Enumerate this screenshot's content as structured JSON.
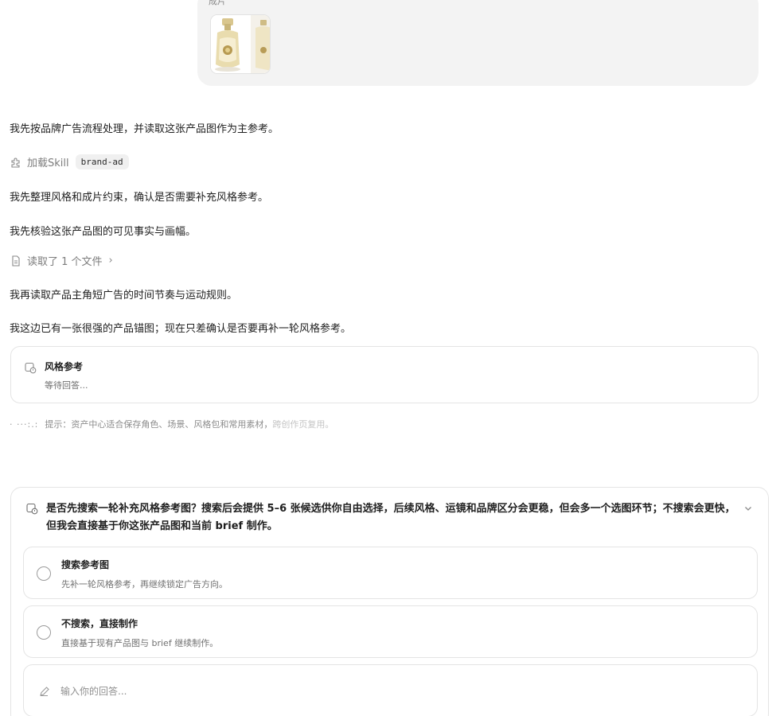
{
  "user_message": {
    "partial_text": "成片",
    "attachment": {
      "kind": "product-image-thumbnail"
    }
  },
  "assistant": {
    "line1": "我先按品牌广告流程处理，并读取这张产品图作为主参考。",
    "skill": {
      "label": "加载Skill",
      "tag": "brand-ad",
      "icon": "puzzle-icon"
    },
    "line2": "我先整理风格和成片约束，确认是否需要补充风格参考。",
    "line3": "我先核验这张产品图的可见事实与画幅。",
    "file_read": {
      "label": "读取了 1 个文件",
      "chevron": "›",
      "icon": "file-icon"
    },
    "line4": "我再读取产品主角短广告的时间节奏与运动规则。",
    "line5": "我这边已有一张很强的产品锚图；现在只差确认是否要再补一轮风格参考。"
  },
  "pending_card": {
    "title": "风格参考",
    "status": "等待回答...",
    "icon": "question-card-icon"
  },
  "tip": {
    "dots": "· ···:.:",
    "text": "提示：资产中心适合保存角色、场景、风格包和常用素材，",
    "faint": "跨创作页复用。"
  },
  "question_panel": {
    "question": "是否先搜索一轮补充风格参考图？搜索后会提供 5–6 张候选供你自由选择，后续风格、运镜和品牌区分会更稳，但会多一个选图环节；不搜索会更快，但我会直接基于你这张产品图和当前 brief 制作。",
    "options": [
      {
        "title": "搜索参考图",
        "desc": "先补一轮风格参考，再继续锁定广告方向。"
      },
      {
        "title": "不搜索，直接制作",
        "desc": "直接基于现有产品图与 brief 继续制作。"
      }
    ],
    "answer_placeholder": "输入你的回答..."
  },
  "colors": {
    "bubble_bg": "#f3f3f3",
    "border": "#e4e4e4",
    "muted": "#7d7d7d"
  }
}
